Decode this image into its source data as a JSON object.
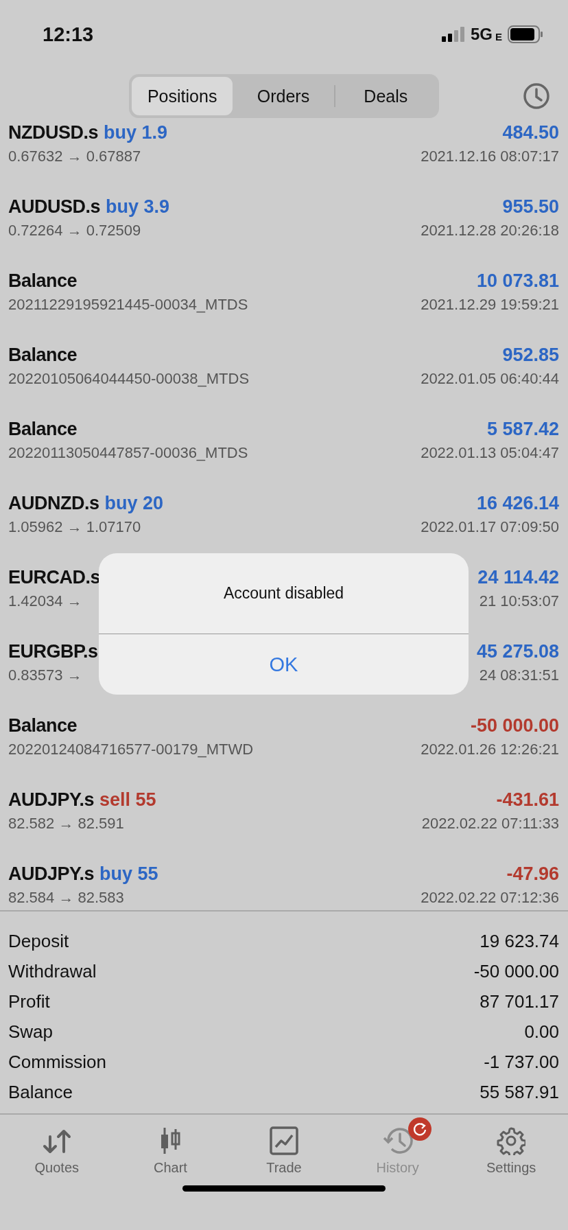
{
  "status_bar": {
    "time": "12:13",
    "network": "5G",
    "network_suffix": "E"
  },
  "segments": [
    {
      "label": "Positions",
      "selected": true
    },
    {
      "label": "Orders",
      "selected": false
    },
    {
      "label": "Deals",
      "selected": false
    }
  ],
  "rows": [
    {
      "kind": "trade",
      "symbol": "NZDUSD.s",
      "action": {
        "text": "buy 1.9",
        "kind": "buy"
      },
      "amount": "484.50",
      "loss": false,
      "detail": "0.67632 → 0.67887",
      "time": "2021.12.16 08:07:17"
    },
    {
      "kind": "trade",
      "symbol": "AUDUSD.s",
      "action": {
        "text": "buy 3.9",
        "kind": "buy"
      },
      "amount": "955.50",
      "loss": false,
      "detail": "0.72264 → 0.72509",
      "time": "2021.12.28 20:26:18"
    },
    {
      "kind": "balance",
      "symbol": "Balance",
      "amount": "10 073.81",
      "loss": false,
      "detail": "20211229195921445-00034_MTDS",
      "time": "2021.12.29 19:59:21"
    },
    {
      "kind": "balance",
      "symbol": "Balance",
      "amount": "952.85",
      "loss": false,
      "detail": "20220105064044450-00038_MTDS",
      "time": "2022.01.05 06:40:44"
    },
    {
      "kind": "balance",
      "symbol": "Balance",
      "amount": "5 587.42",
      "loss": false,
      "detail": "20220113050447857-00036_MTDS",
      "time": "2022.01.13 05:04:47"
    },
    {
      "kind": "trade",
      "symbol": "AUDNZD.s",
      "action": {
        "text": "buy 20",
        "kind": "buy"
      },
      "amount": "16 426.14",
      "loss": false,
      "detail": "1.05962 → 1.07170",
      "time": "2022.01.17 07:09:50"
    },
    {
      "kind": "trade",
      "symbol": "EURCAD.s",
      "amount": "24 114.42",
      "loss": false,
      "detail": "1.42034 →",
      "time": "21 10:53:07"
    },
    {
      "kind": "trade",
      "symbol": "EURGBP.s",
      "amount": "45 275.08",
      "loss": false,
      "detail": "0.83573 →",
      "time": "24 08:31:51"
    },
    {
      "kind": "balance",
      "symbol": "Balance",
      "amount": "-50 000.00",
      "loss": true,
      "detail": "20220124084716577-00179_MTWD",
      "time": "2022.01.26 12:26:21"
    },
    {
      "kind": "trade",
      "symbol": "AUDJPY.s",
      "action": {
        "text": "sell 55",
        "kind": "sell"
      },
      "amount": "-431.61",
      "loss": true,
      "detail": "82.582 → 82.591",
      "time": "2022.02.22 07:11:33"
    },
    {
      "kind": "trade",
      "symbol": "AUDJPY.s",
      "action": {
        "text": "buy 55",
        "kind": "buy"
      },
      "amount": "-47.96",
      "loss": true,
      "detail": "82.584 → 82.583",
      "time": "2022.02.22 07:12:36"
    }
  ],
  "summary": [
    {
      "label": "Deposit",
      "value": "19 623.74"
    },
    {
      "label": "Withdrawal",
      "value": "-50 000.00"
    },
    {
      "label": "Profit",
      "value": "87 701.17"
    },
    {
      "label": "Swap",
      "value": "0.00"
    },
    {
      "label": "Commission",
      "value": "-1 737.00"
    },
    {
      "label": "Balance",
      "value": "55 587.91"
    }
  ],
  "dialog": {
    "message": "Account disabled",
    "button": "OK"
  },
  "tab_bar": [
    {
      "label": "Quotes",
      "kind": "quotes",
      "selected": false,
      "badge": false
    },
    {
      "label": "Chart",
      "kind": "chart",
      "selected": false,
      "badge": false
    },
    {
      "label": "Trade",
      "kind": "trade",
      "selected": false,
      "badge": false
    },
    {
      "label": "History",
      "kind": "history",
      "selected": true,
      "badge": true
    },
    {
      "label": "Settings",
      "kind": "settings",
      "selected": false,
      "badge": false
    }
  ]
}
